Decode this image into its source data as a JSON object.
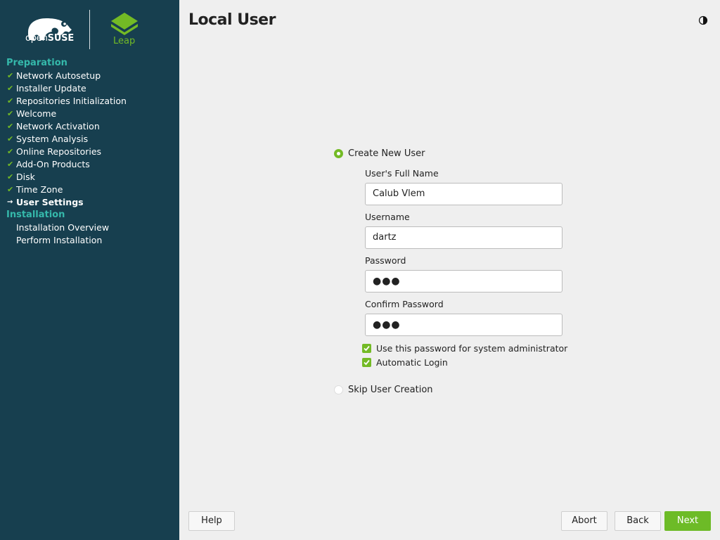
{
  "branding": {
    "distro_prefix": "open",
    "distro_name": "SUSE",
    "edition": "Leap"
  },
  "sidebar": {
    "sections": [
      {
        "heading": "Preparation",
        "steps": [
          {
            "label": "Network Autosetup",
            "state": "done"
          },
          {
            "label": "Installer Update",
            "state": "done"
          },
          {
            "label": "Repositories Initialization",
            "state": "done"
          },
          {
            "label": "Welcome",
            "state": "done"
          },
          {
            "label": "Network Activation",
            "state": "done"
          },
          {
            "label": "System Analysis",
            "state": "done"
          },
          {
            "label": "Online Repositories",
            "state": "done"
          },
          {
            "label": "Add-On Products",
            "state": "done"
          },
          {
            "label": "Disk",
            "state": "done"
          },
          {
            "label": "Time Zone",
            "state": "done"
          },
          {
            "label": "User Settings",
            "state": "current"
          }
        ]
      },
      {
        "heading": "Installation",
        "steps": [
          {
            "label": "Installation Overview",
            "state": "pending"
          },
          {
            "label": "Perform Installation",
            "state": "pending"
          }
        ]
      }
    ]
  },
  "page": {
    "title": "Local User"
  },
  "form": {
    "create_user": {
      "label": "Create New User",
      "selected": true
    },
    "full_name": {
      "label": "User's Full Name",
      "value": "Calub Vlem"
    },
    "username": {
      "label": "Username",
      "value": "dartz"
    },
    "password": {
      "label": "Password",
      "value": "●●●"
    },
    "confirm_password": {
      "label": "Confirm Password",
      "value": "●●●"
    },
    "use_for_admin": {
      "label": "Use this password for system administrator",
      "checked": true
    },
    "auto_login": {
      "label": "Automatic Login",
      "checked": true
    },
    "skip_user": {
      "label": "Skip User Creation",
      "selected": false
    }
  },
  "buttons": {
    "help": "Help",
    "abort": "Abort",
    "back": "Back",
    "next": "Next"
  },
  "icons": {
    "theme_toggle": "half-moon-icon",
    "checkmark": "checkmark-icon",
    "arrow": "arrow-right-icon"
  },
  "colors": {
    "sidebar_bg": "#173f4f",
    "accent_green": "#73ba25",
    "section_heading": "#35b9ab",
    "next_button": "#6dbb27"
  }
}
